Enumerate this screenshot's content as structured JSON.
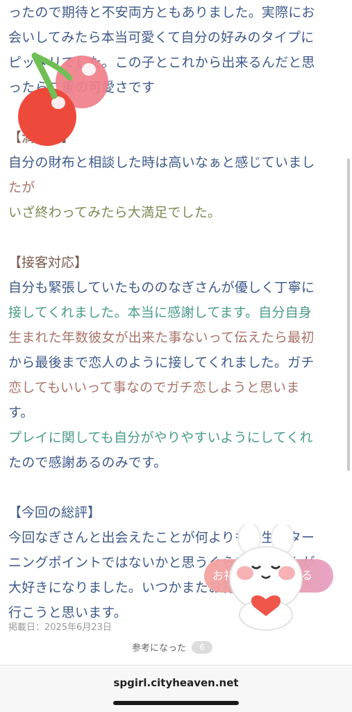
{
  "article": {
    "lines": [
      {
        "text": "ったので期待と不安両方ともありました。実際にお",
        "color": "#3f5a8a"
      },
      {
        "text": "会いしてみたら本当可愛くて自分の好みのタイプに",
        "color": "#3f5a8a"
      },
      {
        "text": "ピッタリでした。この子とこれから出来るんだと思",
        "color": "#3f5a8a"
      },
      {
        "text": "ったら二重の可愛さです",
        "color": "#3f5a8a"
      },
      {
        "text": "",
        "color": "#3f5a8a"
      },
      {
        "text": "【満足度】",
        "color": "#7a5a4e"
      },
      {
        "text": "自分の財布と相談した時は高いなぁと感じていまし",
        "color": "#3f5a8a"
      },
      {
        "text": "たが",
        "color": "#a8746a"
      },
      {
        "text": "いざ終わってみたら大満足でした。",
        "color": "#6e8a5a"
      },
      {
        "text": "",
        "color": "#3f5a8a"
      },
      {
        "text": "【接客対応】",
        "color": "#7a5a4e"
      },
      {
        "text": "自分も緊張していたもののなぎさんが優しく丁寧に",
        "color": "#3f5a8a"
      },
      {
        "text": "接してくれました。本当に感謝してます。自分自身",
        "color": "#3f5a8a"
      },
      {
        "text": "生まれた年数彼女が出来た事ないって伝えたら最初",
        "color": "#3f5a8a"
      },
      {
        "text": "から最後まで恋人のように接してくれました。ガチ",
        "color": "#3f5a8a"
      },
      {
        "text": "恋してもいいって事なのでガチ恋しようと思いま",
        "color": "#3f5a8a"
      },
      {
        "text": "す。",
        "color": "#3f5a8a"
      },
      {
        "text": "プレイに関しても自分がやりやすいようにしてくれ",
        "color": "#3f5a8a"
      },
      {
        "text": "たので感謝あるのみです。",
        "color": "#3f5a8a"
      },
      {
        "text": "",
        "color": "#3f5a8a"
      },
      {
        "text": "【今回の総評】",
        "color": "#3f5a8a"
      },
      {
        "text": "今回なぎさんと出会えたことが何よりも人生のター",
        "color": "#3f5a8a"
      },
      {
        "text": "ニングポイントではないかと思うぐらいなぎさんが",
        "color": "#3f5a8a"
      },
      {
        "text": "大好きになりました。いつかまたお礼を言いに",
        "color": "#3f5a8a"
      },
      {
        "text": "行こうと思います。",
        "color": "#3f5a8a"
      }
    ]
  },
  "posted": "掲載日：2025年6月23日",
  "helpful": {
    "label": "参考になった",
    "count": "6"
  },
  "float_button": {
    "label": "お礼を言いにいける"
  },
  "browser": {
    "url": "spgirl.cityheaven.net"
  },
  "stickers": {
    "top": "cherry-sticker-icon",
    "bottom": "bunny-heart-sticker-icon"
  },
  "colors": {
    "accent_blue": "#3f5a8a",
    "accent_teal": "#4b9b8b",
    "accent_brown": "#a8746a",
    "button_pink": "#f4a3a0"
  }
}
